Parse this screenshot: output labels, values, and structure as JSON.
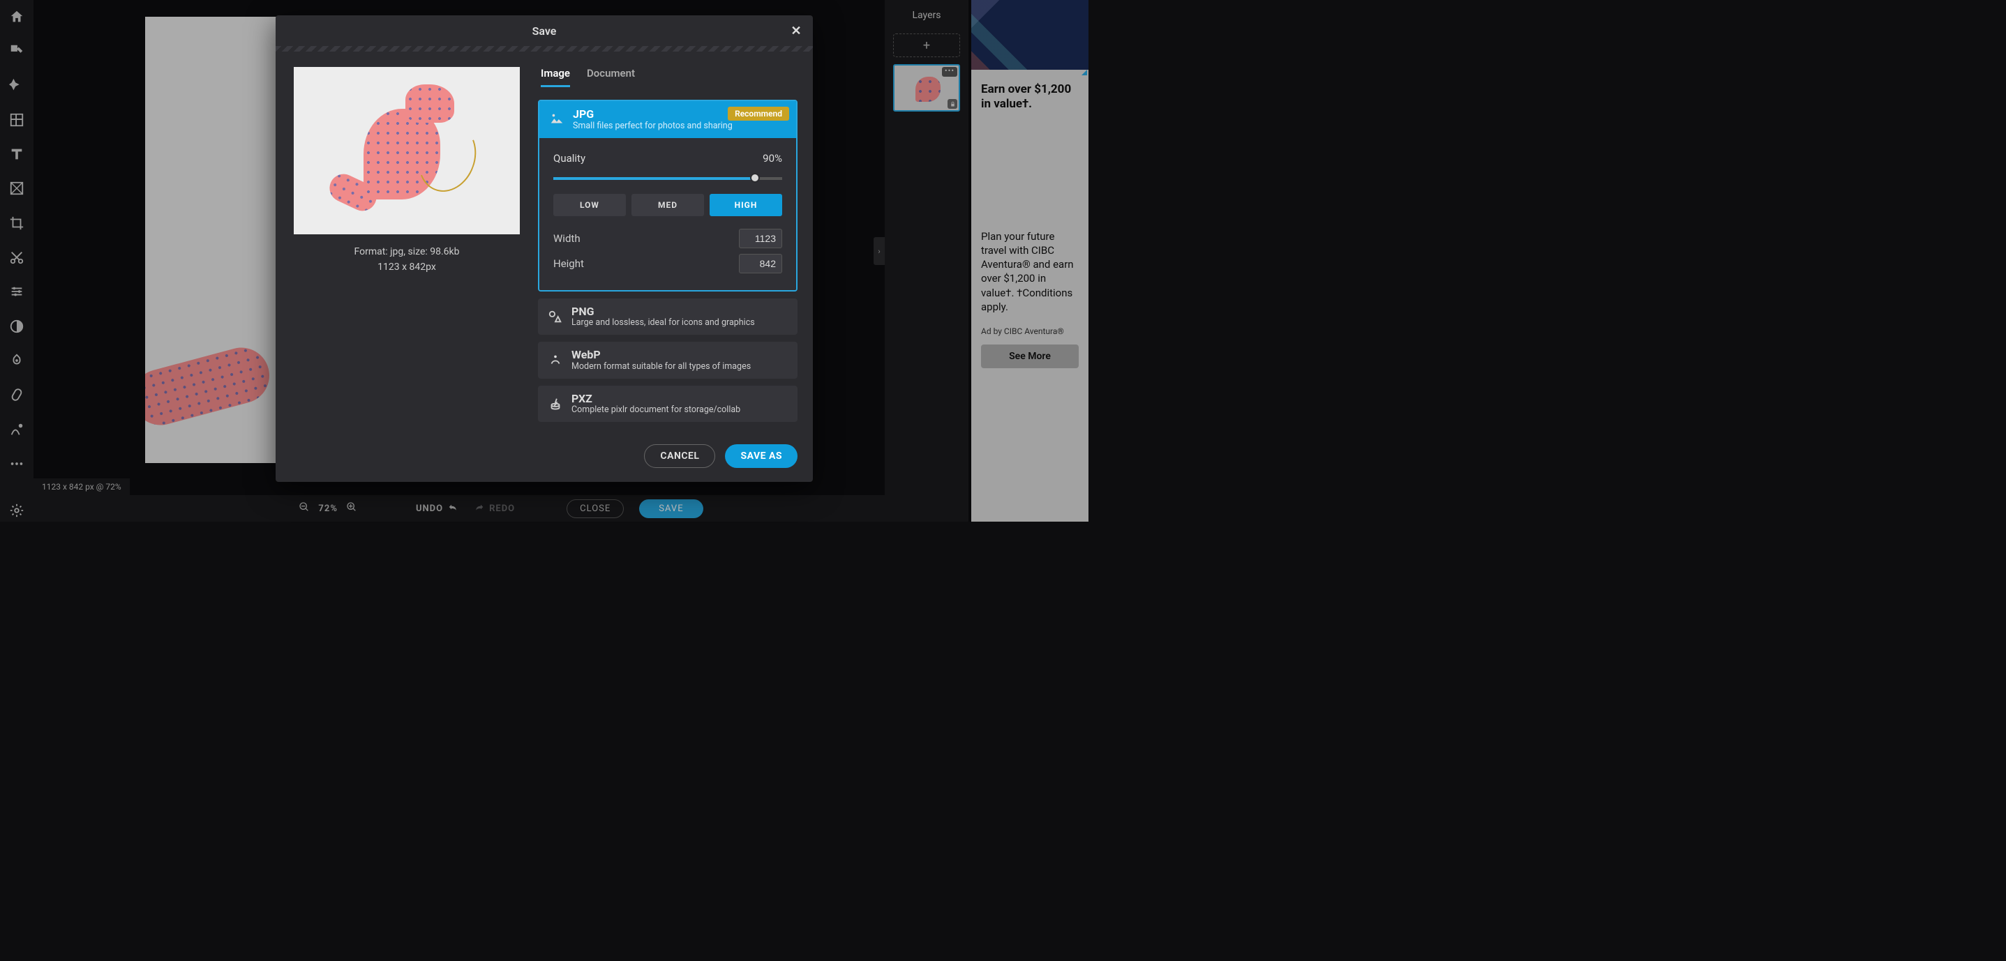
{
  "status_bar": "1123 x 842 px @ 72%",
  "layers": {
    "title": "Layers"
  },
  "footer": {
    "zoom": "72%",
    "undo": "UNDO",
    "redo": "REDO",
    "close": "CLOSE",
    "save": "SAVE"
  },
  "modal": {
    "title": "Save",
    "tabs": {
      "image": "Image",
      "document": "Document"
    },
    "preview": {
      "format_line": "Format: jpg, size: 98.6kb",
      "dim_line": "1123 x 842px"
    },
    "badge": "Recommend",
    "formats": {
      "jpg": {
        "title": "JPG",
        "desc": "Small files perfect for photos and sharing"
      },
      "png": {
        "title": "PNG",
        "desc": "Large and lossless, ideal for icons and graphics"
      },
      "webp": {
        "title": "WebP",
        "desc": "Modern format suitable for all types of images"
      },
      "pxz": {
        "title": "PXZ",
        "desc": "Complete pixlr document for storage/collab"
      }
    },
    "quality": {
      "label": "Quality",
      "value_text": "90%",
      "percent": 90,
      "presets": {
        "low": "LOW",
        "med": "MED",
        "high": "HIGH"
      }
    },
    "width": {
      "label": "Width",
      "value": "1123"
    },
    "height": {
      "label": "Height",
      "value": "842"
    },
    "buttons": {
      "cancel": "CANCEL",
      "saveas": "SAVE AS"
    }
  },
  "ad": {
    "headline": "Earn over $1,200 in value†.",
    "body": "Plan your future travel with CIBC Aventura® and earn over $1,200 in value†. †Conditions apply.",
    "attribution": "Ad by CIBC Aventura®",
    "cta": "See More"
  }
}
